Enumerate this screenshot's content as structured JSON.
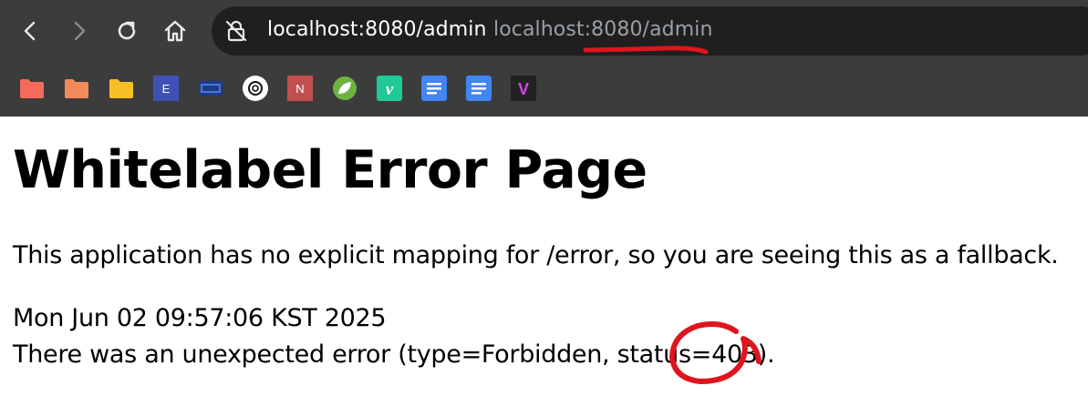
{
  "browser": {
    "url_main": "localhost:8080/admin",
    "url_suggestion": "localhost:8080/admin",
    "bookmarks": [
      {
        "icon": "folder-icon",
        "color": "#f26b5b"
      },
      {
        "icon": "folder-icon",
        "color": "#f28a5b"
      },
      {
        "icon": "folder-icon",
        "color": "#f6bf26"
      },
      {
        "icon": "e-letter-icon",
        "label": "E",
        "color": "#3f51b5"
      },
      {
        "icon": "blue-badge-icon",
        "color": "#1e3a8a"
      },
      {
        "icon": "openai-icon",
        "color": "#ffffff"
      },
      {
        "icon": "n-letter-icon",
        "label": "N",
        "color": "#c0504d"
      },
      {
        "icon": "spring-leaf-icon",
        "color": "#6db33f"
      },
      {
        "icon": "v-letter-icon",
        "label": "v",
        "color": "#20c997"
      },
      {
        "icon": "docs-icon",
        "color": "#4285f4"
      },
      {
        "icon": "docs-icon",
        "color": "#4285f4"
      },
      {
        "icon": "v-dark-icon",
        "label": "V",
        "color": "#d946ef"
      }
    ]
  },
  "page": {
    "title": "Whitelabel Error Page",
    "message": "This application has no explicit mapping for /error, so you are seeing this as a fallback.",
    "timestamp": "Mon Jun 02 09:57:06 KST 2025",
    "error_line": "There was an unexpected error (type=Forbidden, status=403)."
  },
  "annotation_color": "#e0141e"
}
